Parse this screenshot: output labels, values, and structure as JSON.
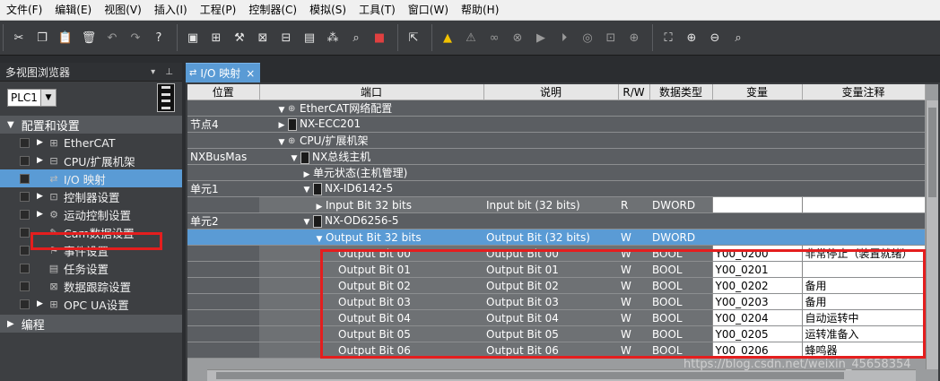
{
  "menu": [
    "文件(F)",
    "编辑(E)",
    "视图(V)",
    "插入(I)",
    "工程(P)",
    "控制器(C)",
    "模拟(S)",
    "工具(T)",
    "窗口(W)",
    "帮助(H)"
  ],
  "left_panel": {
    "title": "多视图浏览器",
    "plc_select": "PLC1",
    "section_config": "配置和设置",
    "items": [
      "EtherCAT",
      "CPU/扩展机架",
      "I/O 映射",
      "控制器设置",
      "运动控制设置",
      "Cam数据设置",
      "事件设置",
      "任务设置",
      "数据跟踪设置",
      "OPC UA设置"
    ],
    "section_program": "编程"
  },
  "tab": {
    "label": "I/O 映射"
  },
  "table": {
    "headers": [
      "位置",
      "端口",
      "说明",
      "R/W",
      "数据类型",
      "变量",
      "变量注释"
    ],
    "rows": [
      {
        "kind": "group",
        "pos": "",
        "indent": 1,
        "tri": "▼",
        "icon": "net",
        "port": "EtherCAT网络配置",
        "desc": "",
        "rw": "",
        "dtype": "",
        "var": "",
        "cmt": ""
      },
      {
        "kind": "group",
        "pos": "节点4",
        "indent": 1,
        "tri": "▶",
        "icon": "dev",
        "port": "NX-ECC201",
        "desc": "",
        "rw": "",
        "dtype": "",
        "var": "",
        "cmt": ""
      },
      {
        "kind": "group",
        "pos": "",
        "indent": 1,
        "tri": "▼",
        "icon": "net",
        "port": "CPU/扩展机架",
        "desc": "",
        "rw": "",
        "dtype": "",
        "var": "",
        "cmt": ""
      },
      {
        "kind": "group",
        "pos": "NXBusMas",
        "indent": 2,
        "tri": "▼",
        "icon": "dev",
        "port": "NX总线主机",
        "desc": "",
        "rw": "",
        "dtype": "",
        "var": "",
        "cmt": ""
      },
      {
        "kind": "group",
        "pos": "",
        "indent": 3,
        "tri": "▶",
        "icon": "",
        "port": "单元状态(主机管理)",
        "desc": "",
        "rw": "",
        "dtype": "",
        "var": "",
        "cmt": ""
      },
      {
        "kind": "group",
        "pos": "单元1",
        "indent": 3,
        "tri": "▼",
        "icon": "dev",
        "port": "NX-ID6142-5",
        "desc": "",
        "rw": "",
        "dtype": "",
        "var": "",
        "cmt": ""
      },
      {
        "kind": "row",
        "pos": "",
        "indent": 4,
        "tri": "▶",
        "icon": "",
        "port": "Input Bit 32 bits",
        "desc": "Input bit (32 bits)",
        "rw": "R",
        "dtype": "DWORD",
        "var": "",
        "cmt": "",
        "white": true
      },
      {
        "kind": "group",
        "pos": "单元2",
        "indent": 3,
        "tri": "▼",
        "icon": "dev",
        "port": "NX-OD6256-5",
        "desc": "",
        "rw": "",
        "dtype": "",
        "var": "",
        "cmt": ""
      },
      {
        "kind": "sel",
        "pos": "",
        "indent": 4,
        "tri": "▼",
        "icon": "",
        "port": "Output Bit 32 bits",
        "desc": "Output Bit (32 bits)",
        "rw": "W",
        "dtype": "DWORD",
        "var": "",
        "cmt": ""
      },
      {
        "kind": "row",
        "pos": "",
        "indent": 5,
        "tri": "",
        "icon": "",
        "port": "Output Bit 00",
        "desc": "Output Bit 00",
        "rw": "W",
        "dtype": "BOOL",
        "var": "Y00_0200",
        "cmt": "非常停止（装置就绪）",
        "white": true
      },
      {
        "kind": "row",
        "pos": "",
        "indent": 5,
        "tri": "",
        "icon": "",
        "port": "Output Bit 01",
        "desc": "Output Bit 01",
        "rw": "W",
        "dtype": "BOOL",
        "var": "Y00_0201",
        "cmt": "",
        "white": true
      },
      {
        "kind": "row",
        "pos": "",
        "indent": 5,
        "tri": "",
        "icon": "",
        "port": "Output Bit 02",
        "desc": "Output Bit 02",
        "rw": "W",
        "dtype": "BOOL",
        "var": "Y00_0202",
        "cmt": "备用",
        "white": true
      },
      {
        "kind": "row",
        "pos": "",
        "indent": 5,
        "tri": "",
        "icon": "",
        "port": "Output Bit 03",
        "desc": "Output Bit 03",
        "rw": "W",
        "dtype": "BOOL",
        "var": "Y00_0203",
        "cmt": "备用",
        "white": true
      },
      {
        "kind": "row",
        "pos": "",
        "indent": 5,
        "tri": "",
        "icon": "",
        "port": "Output Bit 04",
        "desc": "Output Bit 04",
        "rw": "W",
        "dtype": "BOOL",
        "var": "Y00_0204",
        "cmt": "自动运转中",
        "white": true
      },
      {
        "kind": "row",
        "pos": "",
        "indent": 5,
        "tri": "",
        "icon": "",
        "port": "Output Bit 05",
        "desc": "Output Bit 05",
        "rw": "W",
        "dtype": "BOOL",
        "var": "Y00_0205",
        "cmt": "运转准备入",
        "white": true
      },
      {
        "kind": "row",
        "pos": "",
        "indent": 5,
        "tri": "",
        "icon": "",
        "port": "Output Bit 06",
        "desc": "Output Bit 06",
        "rw": "W",
        "dtype": "BOOL",
        "var": "Y00_0206",
        "cmt": "蜂鸣器",
        "white": true
      }
    ]
  },
  "watermark": "https://blog.csdn.net/weixin_45658354"
}
